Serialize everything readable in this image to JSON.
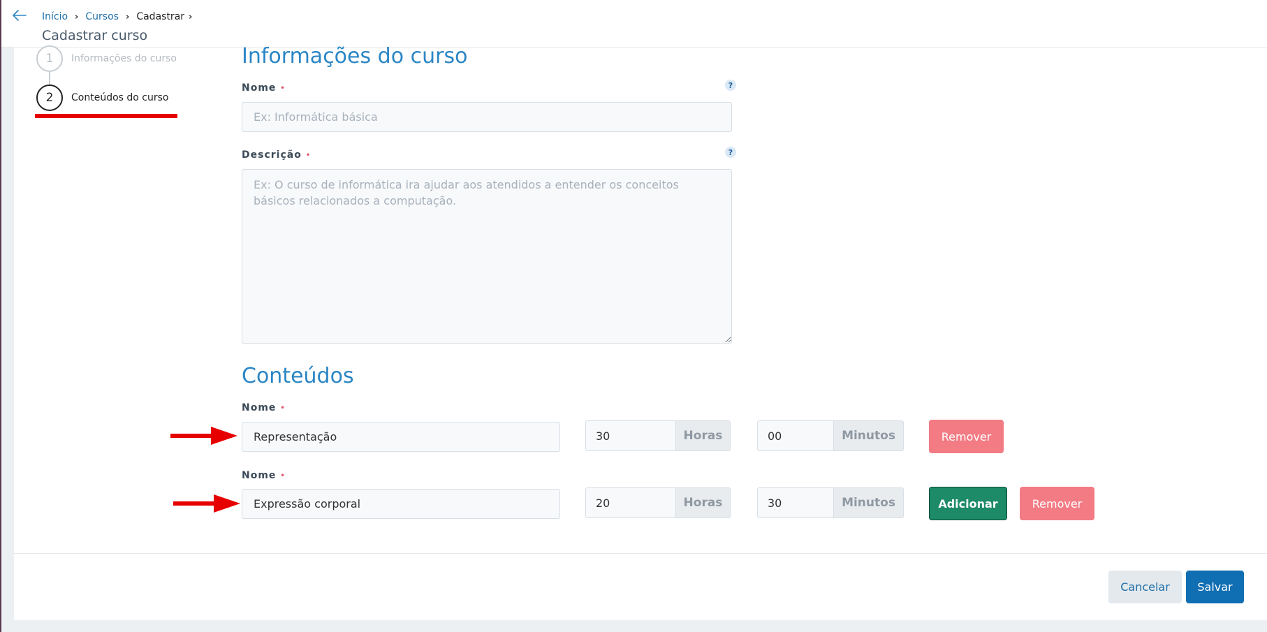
{
  "breadcrumb": {
    "items": [
      "Início",
      "Cursos",
      "Cadastrar"
    ]
  },
  "page_title": "Cadastrar curso",
  "stepper": {
    "steps": [
      {
        "number": "1",
        "label": "Informações do curso"
      },
      {
        "number": "2",
        "label": "Conteúdos do curso"
      }
    ]
  },
  "course_info": {
    "section_title": "Informações do curso",
    "name_label": "Nome",
    "name_placeholder": "Ex: Informática básica",
    "name_value": "",
    "description_label": "Descrição",
    "description_placeholder": "Ex: O curso de informática ira ajudar aos atendidos a entender os conceitos básicos relacionados a computação.",
    "required_marker": "•",
    "help_symbol": "?"
  },
  "contents": {
    "section_title": "Conteúdos",
    "rows": [
      {
        "name_label": "Nome",
        "name_value": "Representação",
        "hours": "30",
        "hours_unit": "Horas",
        "minutes": "00",
        "minutes_unit": "Minutos",
        "remove_label": "Remover"
      },
      {
        "name_label": "Nome",
        "name_value": "Expressão corporal",
        "hours": "20",
        "hours_unit": "Horas",
        "minutes": "30",
        "minutes_unit": "Minutos",
        "add_label": "Adicionar",
        "remove_label": "Remover"
      }
    ]
  },
  "footer": {
    "cancel_label": "Cancelar",
    "save_label": "Salvar"
  },
  "colors": {
    "accent": "#2b86c5",
    "remove": "#f27b84",
    "add": "#1d8a68",
    "save": "#106eb3",
    "annotation": "#e60000"
  }
}
